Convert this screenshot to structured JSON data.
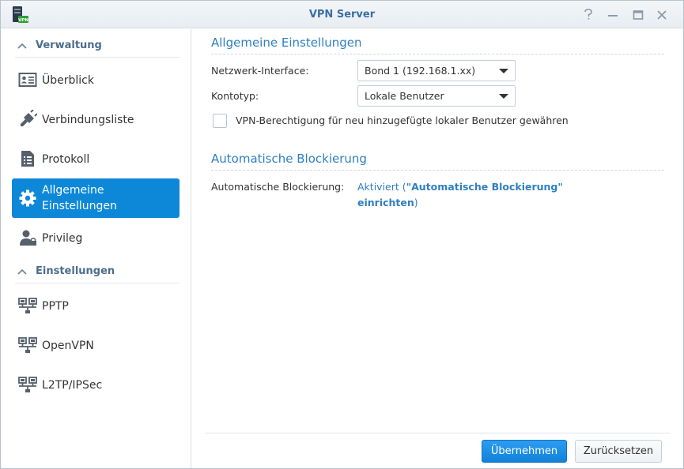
{
  "window": {
    "title": "VPN Server",
    "app_icon_badge": "VPN"
  },
  "sidebar": {
    "sections": [
      {
        "label": "Verwaltung"
      },
      {
        "label": "Einstellungen"
      }
    ],
    "items": [
      {
        "label": "Überblick",
        "icon": "overview-card-icon"
      },
      {
        "label": "Verbindungsliste",
        "icon": "plug-icon"
      },
      {
        "label": "Protokoll",
        "icon": "document-icon"
      },
      {
        "label": "Allgemeine Einstellungen",
        "icon": "gear-icon",
        "active": true
      },
      {
        "label": "Privileg",
        "icon": "user-lock-icon"
      },
      {
        "label": "PPTP",
        "icon": "network-icon"
      },
      {
        "label": "OpenVPN",
        "icon": "network-icon"
      },
      {
        "label": "L2TP/IPSec",
        "icon": "network-icon"
      }
    ]
  },
  "general": {
    "heading": "Allgemeine Einstellungen",
    "interface_label": "Netzwerk-Interface:",
    "interface_value": "Bond 1 (192.168.1.xx)",
    "account_label": "Kontotyp:",
    "account_value": "Lokale Benutzer",
    "vpn_permission_label": "VPN-Berechtigung für neu hinzugefügte lokaler Benutzer gewähren",
    "vpn_permission_checked": false
  },
  "blocking": {
    "heading": "Automatische Blockierung",
    "label": "Automatische Blockierung:",
    "status": "Aktiviert",
    "open_paren": " (",
    "link": "\"Automatische Blockierung\" einrichten",
    "close_paren": ")"
  },
  "buttons": {
    "apply": "Übernehmen",
    "reset": "Zurücksetzen"
  },
  "colors": {
    "accent": "#0d88d8",
    "heading": "#2f7fc1",
    "title": "#3a6ea5"
  }
}
